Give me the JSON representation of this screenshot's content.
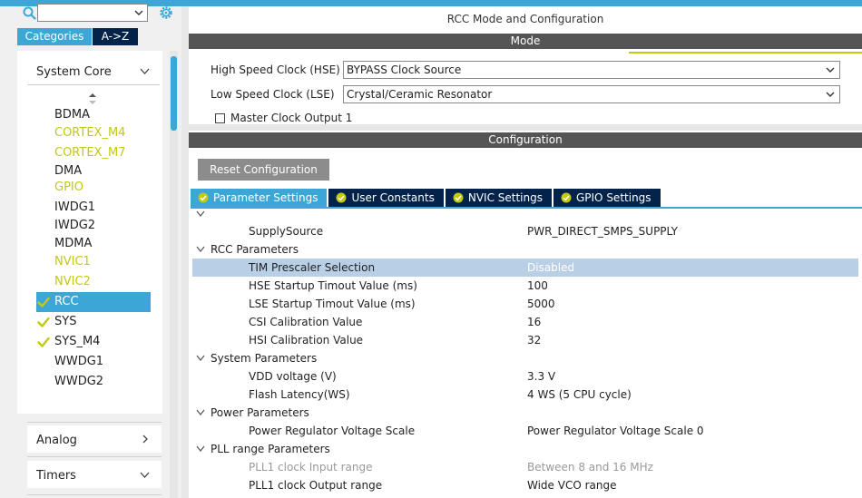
{
  "left": {
    "tabs": {
      "categories": "Categories",
      "az": "A->Z"
    },
    "system_core": "System Core",
    "peripherals": [
      {
        "label": "BDMA",
        "status": "none"
      },
      {
        "label": "CORTEX_M4",
        "status": "warning"
      },
      {
        "label": "CORTEX_M7",
        "status": "warning"
      },
      {
        "label": "DMA",
        "status": "none"
      },
      {
        "label": "GPIO",
        "status": "warning"
      },
      {
        "label": "IWDG1",
        "status": "none"
      },
      {
        "label": "IWDG2",
        "status": "none"
      },
      {
        "label": "MDMA",
        "status": "none"
      },
      {
        "label": "NVIC1",
        "status": "warning"
      },
      {
        "label": "NVIC2",
        "status": "warning"
      },
      {
        "label": "RCC",
        "status": "selected-check"
      },
      {
        "label": "SYS",
        "status": "check"
      },
      {
        "label": "SYS_M4",
        "status": "check"
      },
      {
        "label": "WWDG1",
        "status": "none"
      },
      {
        "label": "WWDG2",
        "status": "none"
      }
    ],
    "groups": {
      "analog": "Analog",
      "timers": "Timers"
    }
  },
  "right": {
    "title": "RCC Mode and Configuration",
    "mode_header": "Mode",
    "hse_label": "High Speed Clock (HSE)",
    "hse_value": "BYPASS Clock Source",
    "lse_label": "Low Speed Clock (LSE)",
    "lse_value": "Crystal/Ceramic Resonator",
    "mco_label": "Master Clock Output 1",
    "config_header": "Configuration",
    "reset_button": "Reset Configuration",
    "tabs": {
      "parameter": "Parameter Settings",
      "user_constants": "User Constants",
      "nvic": "NVIC Settings",
      "gpio": "GPIO Settings"
    },
    "rows": {
      "supply_name": "SupplySource",
      "supply_value": "PWR_DIRECT_SMPS_SUPPLY",
      "rcc_section": "RCC Parameters",
      "tim_name": "TIM Prescaler Selection",
      "tim_value": "Disabled",
      "hse_start_name": "HSE Startup Timout Value (ms)",
      "hse_start_value": "100",
      "lse_start_name": "LSE Startup Timout Value (ms)",
      "lse_start_value": "5000",
      "csi_name": "CSI Calibration Value",
      "csi_value": "16",
      "hsi_name": "HSI Calibration Value",
      "hsi_value": "32",
      "sys_section": "System Parameters",
      "vdd_name": "VDD voltage (V)",
      "vdd_value": "3.3 V",
      "flash_name": "Flash Latency(WS)",
      "flash_value": "4 WS (5 CPU cycle)",
      "power_section": "Power Parameters",
      "prvs_name": "Power Regulator Voltage Scale",
      "prvs_value": "Power Regulator Voltage Scale 0",
      "pll_section": "PLL range Parameters",
      "pll1_in_name": "PLL1 clock Input range",
      "pll1_in_value": "Between 8 and 16 MHz",
      "pll1_out_name": "PLL1 clock Output range",
      "pll1_out_value": "Wide VCO range"
    }
  },
  "colors": {
    "accent_blue": "#3ca7d6",
    "navy": "#03234b",
    "warning_yellow": "#c2c910",
    "highlight_row": "#b9cfe6"
  }
}
